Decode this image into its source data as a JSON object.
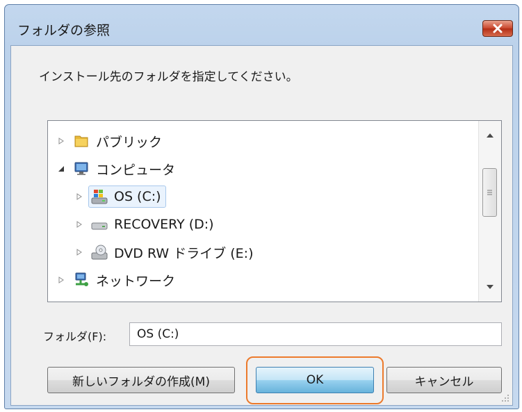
{
  "dialog": {
    "title": "フォルダの参照",
    "instruction": "インストール先のフォルダを指定してください。"
  },
  "tree": {
    "items": [
      {
        "label": "パブリック",
        "icon": "folder-icon",
        "expander": "collapsed"
      },
      {
        "label": "コンピュータ",
        "icon": "computer-icon",
        "expander": "expanded"
      },
      {
        "label": "OS (C:)",
        "icon": "windows-drive-icon",
        "expander": "collapsed",
        "selected": true
      },
      {
        "label": "RECOVERY (D:)",
        "icon": "hard-drive-icon",
        "expander": "collapsed"
      },
      {
        "label": "DVD RW ドライブ (E:)",
        "icon": "dvd-drive-icon",
        "expander": "collapsed"
      },
      {
        "label": "ネットワーク",
        "icon": "network-icon",
        "expander": "collapsed"
      }
    ]
  },
  "folder_field": {
    "label": "フォルダ(F):",
    "value": "OS (C:)"
  },
  "buttons": {
    "new_folder": "新しいフォルダの作成(M)",
    "ok": "OK",
    "cancel": "キャンセル"
  },
  "colors": {
    "highlight": "#ec7a2c",
    "selection_bg": "#eaf3fd",
    "window_frame": "#c3d7ee"
  }
}
